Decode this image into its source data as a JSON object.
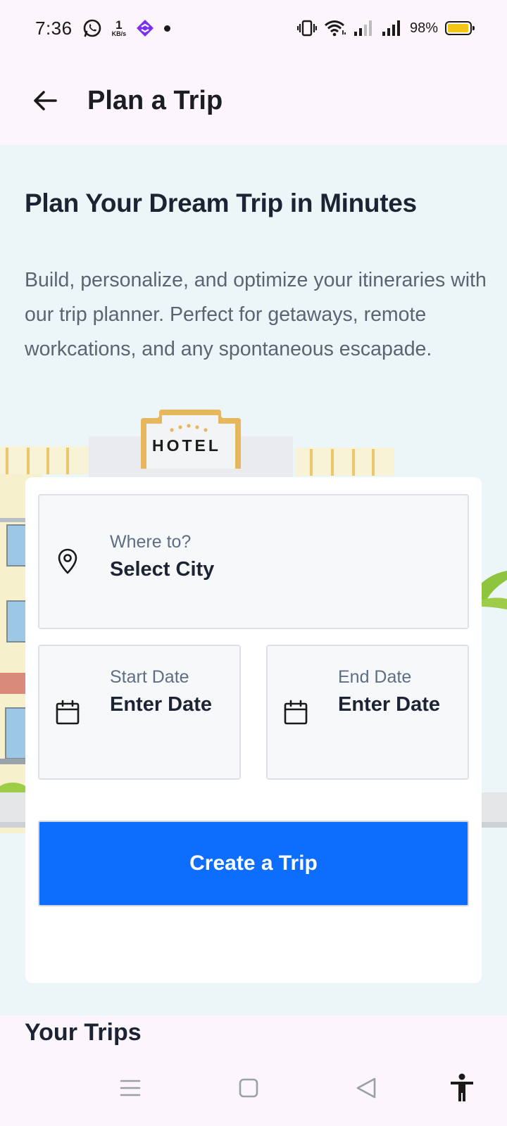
{
  "status_bar": {
    "time": "7:36",
    "net_speed_value": "1",
    "net_speed_unit": "KB/s",
    "battery_percent": "98%",
    "battery_level": 0.98,
    "battery_color": "#f5c518"
  },
  "app_bar": {
    "title": "Plan a Trip",
    "back_icon": "arrow-left-icon"
  },
  "hero": {
    "title": "Plan Your Dream Trip in Minutes",
    "description": "Build, personalize, and optimize your itineraries with our trip planner. Perfect for getaways, remote workcations, and any spontaneous escapade.",
    "hotel_sign": "HOTEL"
  },
  "form": {
    "city": {
      "label": "Where to?",
      "value": "Select City",
      "icon": "location-pin-icon"
    },
    "start_date": {
      "label": "Start Date",
      "value": "Enter Date",
      "icon": "calendar-icon"
    },
    "end_date": {
      "label": "End Date",
      "value": "Enter Date",
      "icon": "calendar-icon"
    },
    "submit_label": "Create a Trip",
    "accent_color": "#0d6efd"
  },
  "trips": {
    "title": "Your Trips"
  },
  "nav_bar": {
    "items": [
      "menu-icon",
      "home-square-icon",
      "back-triangle-icon",
      "accessibility-icon"
    ]
  }
}
